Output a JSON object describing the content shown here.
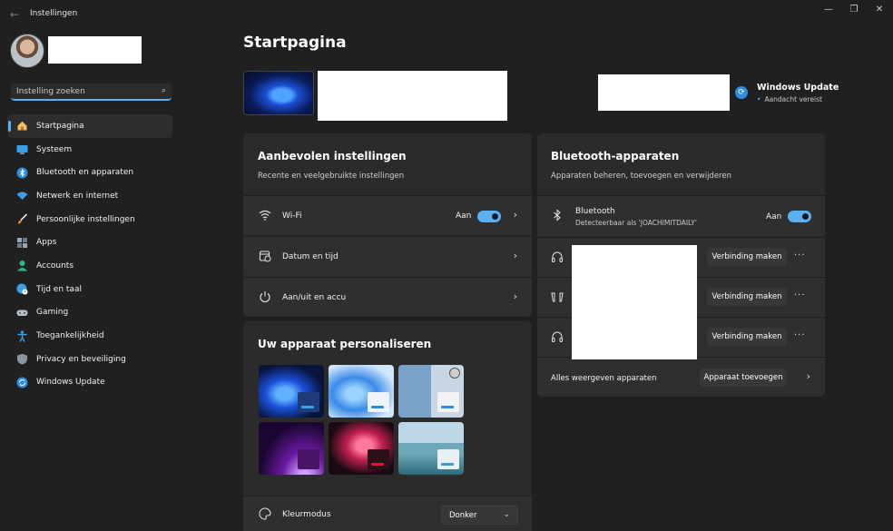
{
  "app": {
    "title": "Instellingen"
  },
  "window_controls": {
    "minimize": "—",
    "restore": "❐",
    "close": "✕"
  },
  "search": {
    "placeholder": "Instelling zoeken",
    "value": ""
  },
  "nav": {
    "items": [
      {
        "label": "Startpagina",
        "icon": "home-icon",
        "active": true
      },
      {
        "label": "Systeem",
        "icon": "monitor-icon"
      },
      {
        "label": "Bluetooth en apparaten",
        "icon": "bluetooth-icon"
      },
      {
        "label": "Netwerk en internet",
        "icon": "wifi-icon"
      },
      {
        "label": "Persoonlijke instellingen",
        "icon": "brush-icon"
      },
      {
        "label": "Apps",
        "icon": "apps-icon"
      },
      {
        "label": "Accounts",
        "icon": "person-icon"
      },
      {
        "label": "Tijd en taal",
        "icon": "globe-clock-icon"
      },
      {
        "label": "Gaming",
        "icon": "gamepad-icon"
      },
      {
        "label": "Toegankelijkheid",
        "icon": "accessibility-icon"
      },
      {
        "label": "Privacy en beveiliging",
        "icon": "shield-icon"
      },
      {
        "label": "Windows Update",
        "icon": "update-icon"
      }
    ]
  },
  "main": {
    "title": "Startpagina",
    "windows_update": {
      "title": "Windows Update",
      "status": "Aandacht vereist"
    },
    "recommended": {
      "title": "Aanbevolen instellingen",
      "subtitle": "Recente en veelgebruikte instellingen",
      "rows": [
        {
          "label": "Wi-Fi",
          "icon": "wifi-icon",
          "toggle_label": "Aan",
          "on": true
        },
        {
          "label": "Datum en tijd",
          "icon": "calendar-clock-icon"
        },
        {
          "label": "Aan/uit en accu",
          "icon": "power-icon"
        }
      ]
    },
    "personalize": {
      "title": "Uw apparaat personaliseren",
      "color_mode": {
        "label": "Kleurmodus",
        "value": "Donker",
        "icon": "palette-icon"
      }
    },
    "bluetooth": {
      "title": "Bluetooth-apparaten",
      "subtitle": "Apparaten beheren, toevoegen en verwijderen",
      "bt_label": "Bluetooth",
      "bt_detail": "Detecteerbaar als 'JOACHIMITDAILY'",
      "toggle_label": "Aan",
      "devices": [
        {
          "icon": "headphones-icon",
          "button": "Verbinding maken"
        },
        {
          "icon": "earbuds-icon",
          "button": "Verbinding maken"
        },
        {
          "icon": "headphones-icon",
          "button": "Verbinding maken"
        }
      ],
      "more": "···",
      "show_all": "Alles weergeven apparaten",
      "add_button": "Apparaat toevoegen"
    }
  },
  "colors": {
    "accent": "#5ab0f0",
    "background": "#202020",
    "card": "#2b2b2b"
  }
}
